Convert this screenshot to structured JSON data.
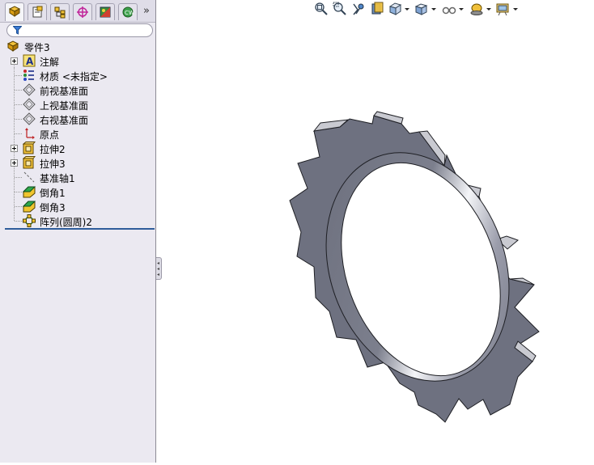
{
  "feature_tree": {
    "root": "零件3",
    "items": [
      {
        "label": "注解",
        "icon": "annotations-icon",
        "expandable": true
      },
      {
        "label": "材质 <未指定>",
        "icon": "material-icon",
        "expandable": false
      },
      {
        "label": "前视基准面",
        "icon": "plane-icon",
        "expandable": false
      },
      {
        "label": "上视基准面",
        "icon": "plane-icon",
        "expandable": false
      },
      {
        "label": "右视基准面",
        "icon": "plane-icon",
        "expandable": false
      },
      {
        "label": "原点",
        "icon": "origin-icon",
        "expandable": false
      },
      {
        "label": "拉伸2",
        "icon": "extrude-icon",
        "expandable": true
      },
      {
        "label": "拉伸3",
        "icon": "extrude-icon",
        "expandable": true
      },
      {
        "label": "基准轴1",
        "icon": "axis-icon",
        "expandable": false
      },
      {
        "label": "倒角1",
        "icon": "chamfer-icon",
        "expandable": false
      },
      {
        "label": "倒角3",
        "icon": "chamfer-icon",
        "expandable": false
      },
      {
        "label": "阵列(圆周)2",
        "icon": "circular-pattern-icon",
        "expandable": false
      }
    ]
  },
  "manager_tabs": [
    "feature-manager-icon",
    "property-manager-icon",
    "configuration-manager-icon",
    "dimxpert-icon",
    "display-manager-icon",
    "cam-icon"
  ],
  "more_tabs_label": "»",
  "heads_up_toolbar": [
    "zoom-to-fit-icon",
    "zoom-to-area-icon",
    "previous-view-icon",
    "section-view-icon",
    "view-orientation-icon",
    "display-style-icon",
    "hide-show-items-icon",
    "edit-appearance-icon",
    "apply-scene-icon"
  ],
  "colors": {
    "panel_bg": "#ebe9f1",
    "model_face": "#6e7180",
    "model_top": "#c9cad1",
    "rollback_bar": "#2f5c9a"
  }
}
